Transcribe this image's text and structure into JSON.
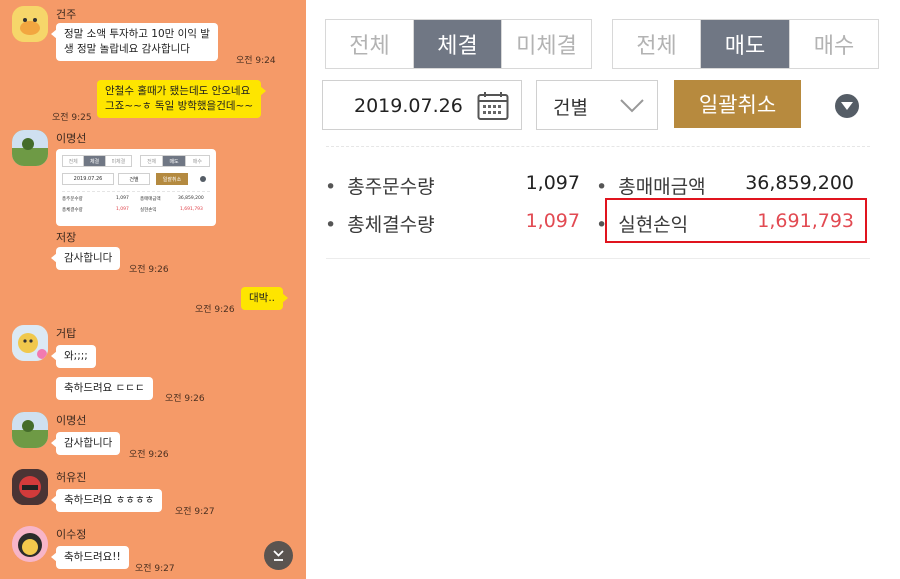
{
  "chat": {
    "messages": [
      {
        "sender": "건주",
        "lines": [
          "정말 소액 투자하고 10만 이익 발",
          "생 정말 놀랍네요 감사합니다"
        ],
        "time": "오전 9:24"
      },
      {
        "sender": "",
        "lines": [
          "안철수 홀때가 됐는데도 안오네요",
          "그죠~~ㅎ 독일 방학했을건데~~"
        ],
        "time": "오전 9:25"
      },
      {
        "sender": "이명선",
        "caption": "저장",
        "reply": "감사합니다",
        "time": "오전 9:26"
      },
      {
        "sender": "",
        "lines": [
          "대박.."
        ],
        "time": "오전 9:26"
      },
      {
        "sender": "거탑",
        "bubble1": "와;;;;",
        "bubble2": "축하드려요 ㄷㄷㄷ",
        "time": "오전 9:26"
      },
      {
        "sender": "이명선",
        "lines": [
          "감사합니다"
        ],
        "time": "오전 9:26"
      },
      {
        "sender": "허유진",
        "lines": [
          "축하드려요 ㅎㅎㅎㅎ"
        ],
        "time": "오전 9:27"
      },
      {
        "sender": "이수정",
        "lines": [
          "축하드려요!!"
        ],
        "time": "오전 9:27"
      }
    ],
    "mini": {
      "seg1": [
        "전체",
        "체결",
        "미체결"
      ],
      "seg2": [
        "전체",
        "매도",
        "매수"
      ],
      "date": "2019.07.26",
      "unit": "건별",
      "cancel": "일괄취소",
      "stats": [
        {
          "label": "총주문수량",
          "value": "1,097"
        },
        {
          "label": "총매매금액",
          "value": "36,859,200"
        },
        {
          "label": "총체결수량",
          "value": "1,097"
        },
        {
          "label": "실현손익",
          "value": "1,691,793"
        }
      ]
    }
  },
  "trade": {
    "filter_status": {
      "options": [
        "전체",
        "체결",
        "미체결"
      ],
      "active": "체결"
    },
    "filter_side": {
      "options": [
        "전체",
        "매도",
        "매수"
      ],
      "active": "매도"
    },
    "date": "2019.07.26",
    "unit": "건별",
    "cancel_all": "일괄취소",
    "stats": {
      "total_order_qty": {
        "label": "총주문수량",
        "value": "1,097"
      },
      "total_trade_amount": {
        "label": "총매매금액",
        "value": "36,859,200"
      },
      "total_exec_qty": {
        "label": "총체결수량",
        "value": "1,097"
      },
      "realized_pnl": {
        "label": "실현손익",
        "value": "1,691,793"
      }
    }
  },
  "colors": {
    "chat_bg": "#f59a68",
    "my_bubble": "#fee500",
    "active_tab": "#707784",
    "gold_button": "#b78a3e",
    "profit_red": "#e24a52",
    "highlight_red": "#e0141e"
  },
  "icons": [
    "calendar-icon",
    "chevron-down-icon",
    "caret-down-icon",
    "scroll-down-icon"
  ]
}
